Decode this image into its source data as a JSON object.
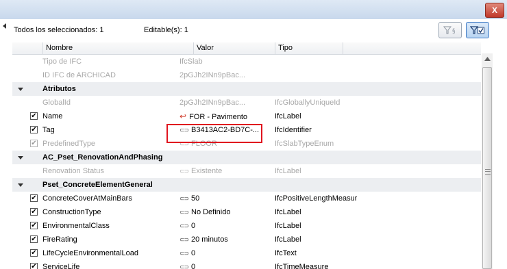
{
  "window": {
    "close_label": "X"
  },
  "summary": {
    "selected_label": "Todos los seleccionados: 1",
    "editable_label": "Editable(s): 1"
  },
  "toolbar": {
    "filter_props_label": "7§",
    "filter_active_label": "Y☑"
  },
  "columns": {
    "name": "Nombre",
    "value": "Valor",
    "type": "Tipo"
  },
  "rows": [
    {
      "kind": "info",
      "name": "Tipo de IFC",
      "value": "IfcSlab",
      "type": ""
    },
    {
      "kind": "info",
      "name": "ID IFC de ARCHICAD",
      "value": "2pGJh2INn9pBac...",
      "type": ""
    },
    {
      "kind": "group",
      "name": "Atributos"
    },
    {
      "kind": "info",
      "name": "GlobalId",
      "value": "2pGJh2INn9pBac...",
      "type": "IfcGloballyUniqueId"
    },
    {
      "kind": "prop",
      "checked": true,
      "dim": false,
      "icon": "undo",
      "name": "Name",
      "value": "FOR - Pavimento",
      "type": "IfcLabel"
    },
    {
      "kind": "prop",
      "checked": true,
      "dim": false,
      "icon": "chain",
      "name": "Tag",
      "value": "B3413AC2-BD7C-...",
      "type": "IfcIdentifier"
    },
    {
      "kind": "prop",
      "checked": true,
      "dim": true,
      "icon": "chain",
      "name": "PredefinedType",
      "value": "FLOOR",
      "type": "IfcSlabTypeEnum"
    },
    {
      "kind": "group",
      "name": "AC_Pset_RenovationAndPhasing"
    },
    {
      "kind": "prop",
      "checked": false,
      "dim": true,
      "icon": "chain",
      "name": "Renovation Status",
      "value": "Existente",
      "type": "IfcLabel"
    },
    {
      "kind": "group",
      "name": "Pset_ConcreteElementGeneral"
    },
    {
      "kind": "prop",
      "checked": true,
      "dim": false,
      "icon": "chain",
      "name": "ConcreteCoverAtMainBars",
      "value": "50",
      "type": "IfcPositiveLengthMeasure"
    },
    {
      "kind": "prop",
      "checked": true,
      "dim": false,
      "icon": "chain",
      "name": "ConstructionType",
      "value": "No Definido",
      "type": "IfcLabel"
    },
    {
      "kind": "prop",
      "checked": true,
      "dim": false,
      "icon": "chain",
      "name": "EnvironmentalClass",
      "value": "0",
      "type": "IfcLabel"
    },
    {
      "kind": "prop",
      "checked": true,
      "dim": false,
      "icon": "chain",
      "name": "FireRating",
      "value": "20 minutos",
      "type": "IfcLabel"
    },
    {
      "kind": "prop",
      "checked": true,
      "dim": false,
      "icon": "chain",
      "name": "LifeCycleEnvironmentalLoad",
      "value": "0",
      "type": "IfcText"
    },
    {
      "kind": "prop",
      "checked": true,
      "dim": false,
      "icon": "chain",
      "name": "ServiceLife",
      "value": "0",
      "type": "IfcTimeMeasure"
    }
  ],
  "icons": {
    "check": "✔",
    "chain": "⊂⊃",
    "undo": "↩"
  }
}
